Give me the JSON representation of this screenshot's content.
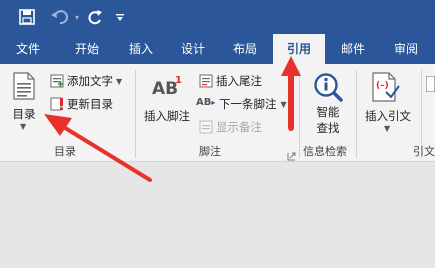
{
  "qat": {
    "save_icon": "save-icon",
    "undo_icon": "undo-icon",
    "redo_icon": "redo-icon",
    "customize_icon": "customize-qat-icon"
  },
  "tabs": [
    {
      "label": "文件"
    },
    {
      "label": "开始"
    },
    {
      "label": "插入"
    },
    {
      "label": "设计"
    },
    {
      "label": "布局"
    },
    {
      "label": "引用",
      "active": true
    },
    {
      "label": "邮件"
    },
    {
      "label": "审阅"
    }
  ],
  "ribbon": {
    "toc": {
      "big_button": "目录",
      "add_text": "添加文字",
      "update_toc": "更新目录",
      "group_label": "目录"
    },
    "footnotes": {
      "insert_footnote": "插入脚注",
      "insert_endnote": "插入尾注",
      "next_footnote": "下一条脚注",
      "show_notes": "显示备注",
      "group_label": "脚注"
    },
    "research": {
      "smart_lookup_line1": "智能",
      "smart_lookup_line2": "查找",
      "group_label": "信息检索"
    },
    "citations": {
      "insert_citation": "插入引文",
      "group_label": "引文"
    }
  },
  "colors": {
    "title_bar": "#2b579a",
    "ribbon_bg": "#f3f3f3",
    "annotation_arrow": "#e8312a"
  }
}
